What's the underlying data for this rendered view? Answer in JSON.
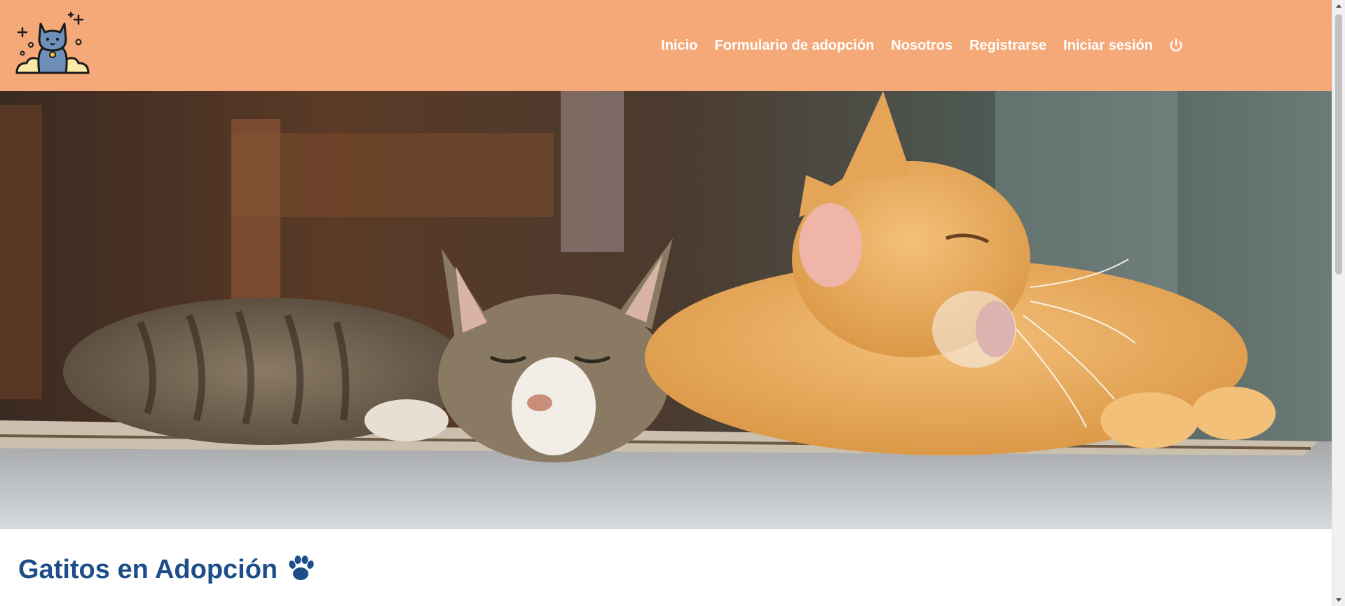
{
  "header": {
    "background": "#f5a878",
    "logo_icon": "cat-logo-icon",
    "nav": {
      "inicio": "Inicio",
      "formulario": "Formulario de adopción",
      "nosotros": "Nosotros",
      "registrarse": "Registrarse",
      "iniciar_sesion": "Iniciar sesión",
      "power_icon": "power-icon"
    }
  },
  "hero": {
    "image": "two-cats-lying-on-rug-photo"
  },
  "main": {
    "title": "Gatitos en Adopción",
    "title_icon": "paw-icon",
    "title_color": "#1d4e89"
  }
}
